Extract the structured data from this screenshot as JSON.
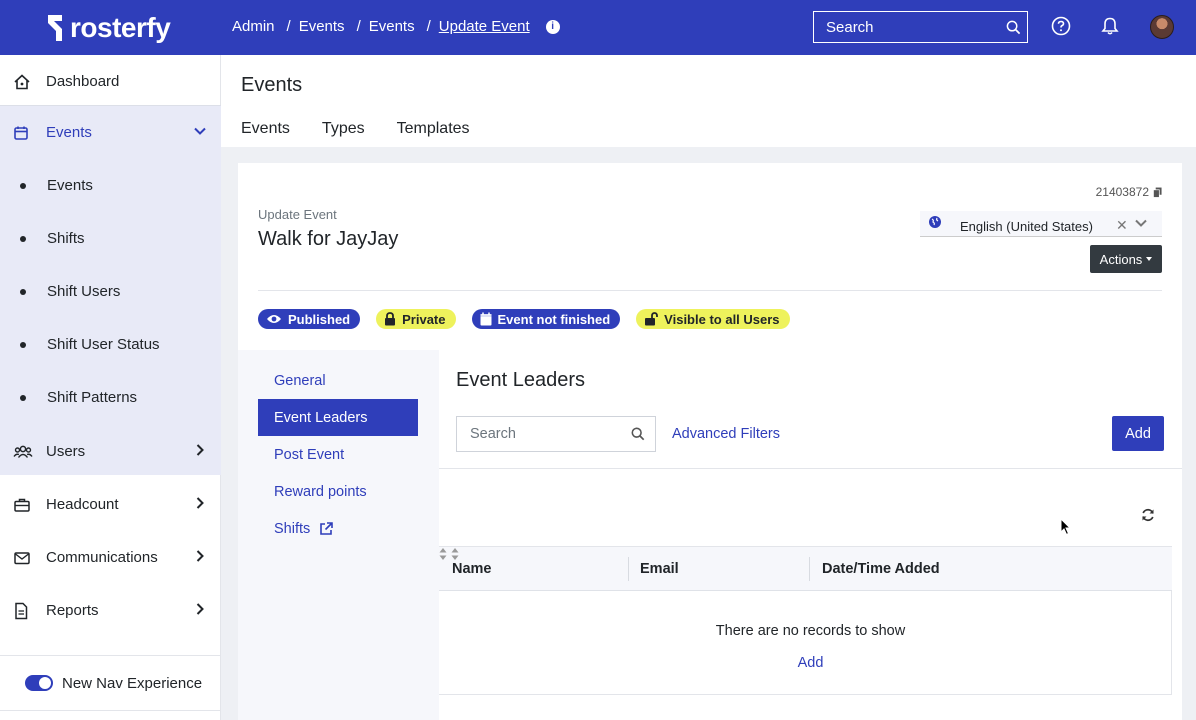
{
  "brand": {
    "name": "rosterfy",
    "primary_color": "#2f3eba",
    "highlight_color": "#eef25c"
  },
  "topbar": {
    "breadcrumbs": [
      "Admin",
      "Events",
      "Events",
      "Update Event"
    ],
    "search_placeholder": "Search",
    "icons": [
      "info-icon",
      "search-icon",
      "help-icon",
      "bell-icon",
      "avatar"
    ]
  },
  "sidebar": {
    "dashboard": "Dashboard",
    "events": "Events",
    "events_sub": [
      "Events",
      "Shifts",
      "Shift Users",
      "Shift User Status",
      "Shift Patterns"
    ],
    "users": "Users",
    "headcount": "Headcount",
    "communications": "Communications",
    "reports": "Reports",
    "toggle_label": "New Nav Experience",
    "toggle_on": true
  },
  "page": {
    "title": "Events",
    "tabs": [
      "Events",
      "Types",
      "Templates"
    ]
  },
  "event": {
    "id": "21403872",
    "subtitle": "Update Event",
    "name": "Walk for JayJay",
    "language": "English (United States)",
    "actions_label": "Actions",
    "badges": {
      "published": "Published",
      "private": "Private",
      "not_finished": "Event not finished",
      "visible": "Visible to all Users"
    }
  },
  "subnav": {
    "items": [
      "General",
      "Event Leaders",
      "Post Event",
      "Reward points",
      "Shifts"
    ],
    "active": "Event Leaders"
  },
  "panel": {
    "title": "Event Leaders",
    "search_placeholder": "Search",
    "advanced_filters": "Advanced Filters",
    "add_label": "Add",
    "columns": [
      "Name",
      "Email",
      "Date/Time Added"
    ],
    "empty_message": "There are no records to show",
    "empty_add": "Add"
  }
}
